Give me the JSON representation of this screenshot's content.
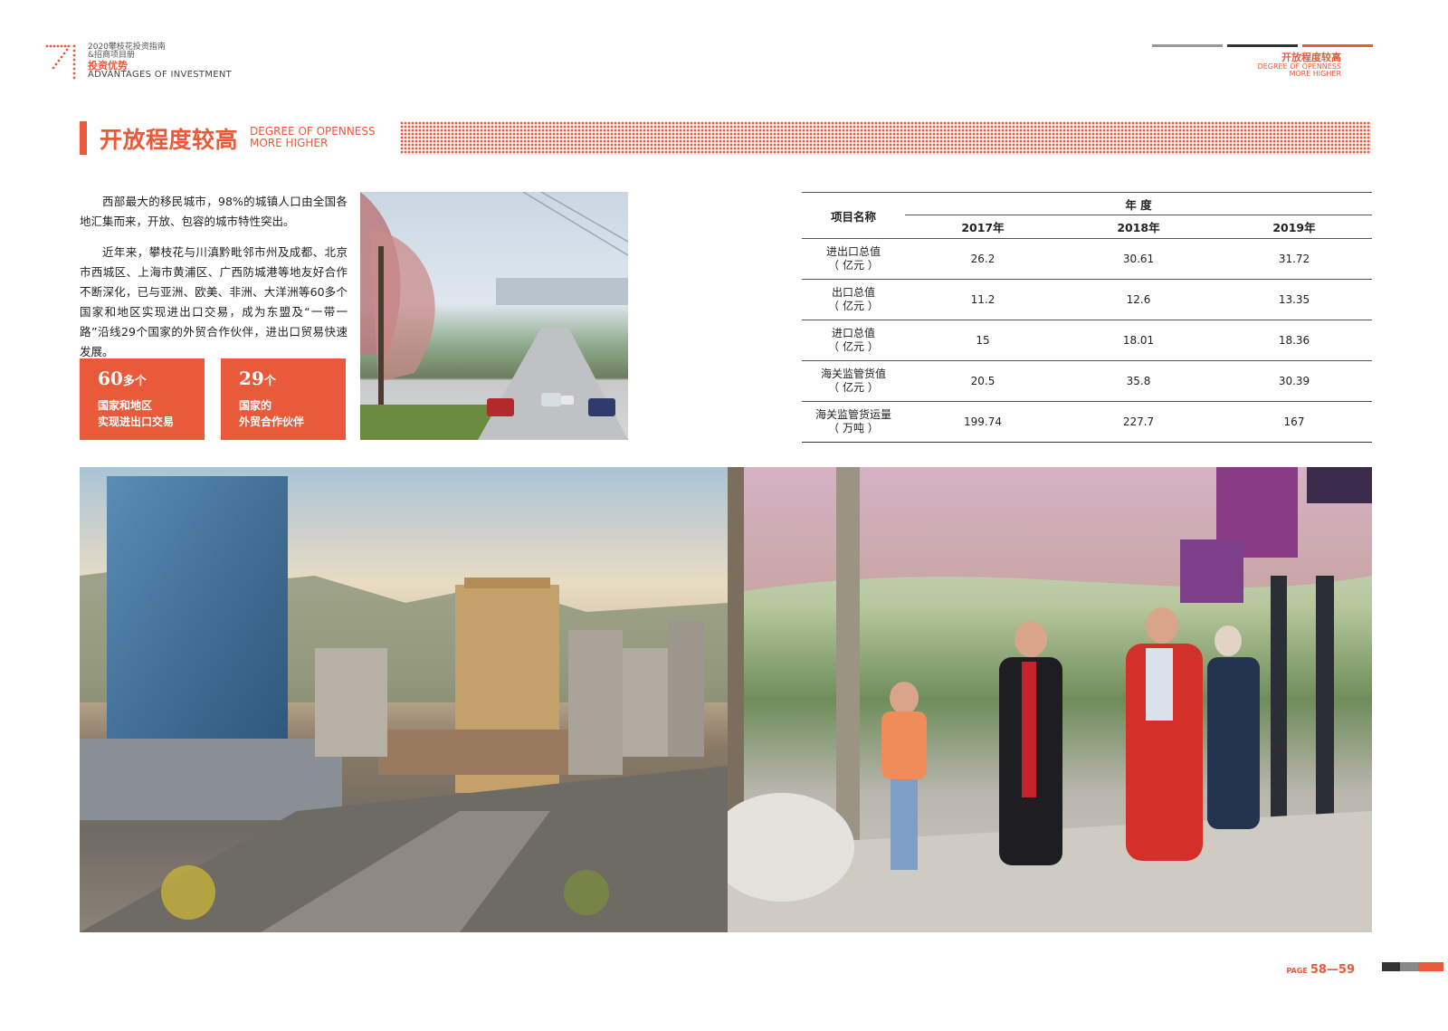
{
  "header": {
    "line1": "2020攀枝花投资指南",
    "line2": "&招商项目册",
    "section_cn": "投资优势",
    "section_en": "ADVANTAGES OF INVESTMENT"
  },
  "top_right": {
    "title_cn": "开放程度较高",
    "title_en_1": "DEGREE OF OPENNESS",
    "title_en_2": "MORE HIGHER"
  },
  "section": {
    "title_cn": "开放程度较高",
    "title_en_1": "DEGREE OF OPENNESS",
    "title_en_2": "MORE HIGHER"
  },
  "intro": {
    "para1": "西部最大的移民城市，98%的城镇人口由全国各地汇集而来，开放、包容的城市特性突出。",
    "para2": "近年来，攀枝花与川滇黔毗邻市州及成都、北京市西城区、上海市黄浦区、广西防城港等地友好合作不断深化，已与亚洲、欧美、非洲、大洋洲等60多个国家和地区实现进出口交易，成为东盟及“一带一路”沿线29个国家的外贸合作伙伴，进出口贸易快速发展。"
  },
  "stats": [
    {
      "number": "60",
      "unit": "多个",
      "line1": "国家和地区",
      "line2": "实现进出口交易"
    },
    {
      "number": "29",
      "unit": "个",
      "line1": "国家的",
      "line2": "外贸合作伙伴"
    }
  ],
  "table": {
    "name_header": "项目名称",
    "year_header": "年  度",
    "years": [
      "2017年",
      "2018年",
      "2019年"
    ],
    "rows": [
      {
        "name": "进出口总值",
        "unit": "（ 亿元 ）",
        "values": [
          "26.2",
          "30.61",
          "31.72"
        ]
      },
      {
        "name": "出口总值",
        "unit": "（ 亿元 ）",
        "values": [
          "11.2",
          "12.6",
          "13.35"
        ]
      },
      {
        "name": "进口总值",
        "unit": "（ 亿元 ）",
        "values": [
          "15",
          "18.01",
          "18.36"
        ]
      },
      {
        "name": "海关监管货值",
        "unit": "（ 亿元 ）",
        "values": [
          "20.5",
          "35.8",
          "30.39"
        ]
      },
      {
        "name": "海关监管货运量",
        "unit": "（ 万吨 ）",
        "values": [
          "199.74",
          "227.7",
          "167"
        ]
      }
    ]
  },
  "colors": {
    "accent": "#e85a3a",
    "text": "#222222"
  },
  "footer": {
    "page_label": "PAGE",
    "page_numbers": "58—59"
  }
}
